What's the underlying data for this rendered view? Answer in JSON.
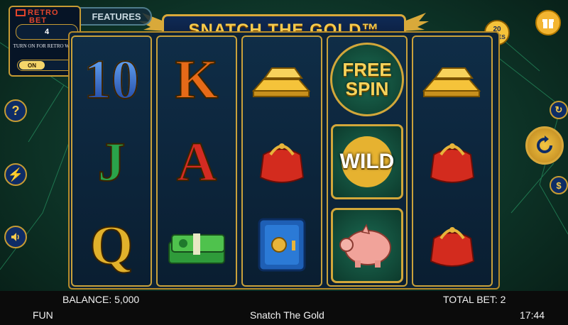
{
  "title": "SNATCH THE GOLD™",
  "features_tab": "FEATURES",
  "retro_bet": {
    "logo_line1": "RETRO",
    "logo_line2": "BET",
    "value": "4",
    "hint": "TURN ON FOR RETRO WILD",
    "toggle_label": "ON"
  },
  "lines_badge": {
    "count": "20",
    "label": "LINES"
  },
  "reels": [
    [
      "ten-symbol",
      "jack-symbol",
      "queen-symbol"
    ],
    [
      "king-symbol",
      "ace-symbol",
      "cash-stack-symbol"
    ],
    [
      "gold-bars-symbol",
      "red-purse-symbol",
      "safe-symbol"
    ],
    [
      "free-spin-symbol",
      "wild-symbol",
      "piggy-bank-symbol"
    ],
    [
      "gold-bars-symbol",
      "red-purse-symbol",
      "red-purse-symbol"
    ]
  ],
  "symbols": {
    "ten": "10",
    "jack": "J",
    "queen": "Q",
    "king": "K",
    "ace": "A",
    "free_spin_line1": "FREE",
    "free_spin_line2": "SPIN",
    "wild": "WILD"
  },
  "bottom": {
    "balance": "BALANCE: 5,000",
    "total_bet": "TOTAL BET: 2",
    "mode": "FUN",
    "game_name": "Snatch The Gold",
    "clock": "17:44"
  },
  "colors": {
    "gold": "#d9a93a",
    "reel_bg": "#0f2d47",
    "bg_green": "#1f5b45"
  }
}
